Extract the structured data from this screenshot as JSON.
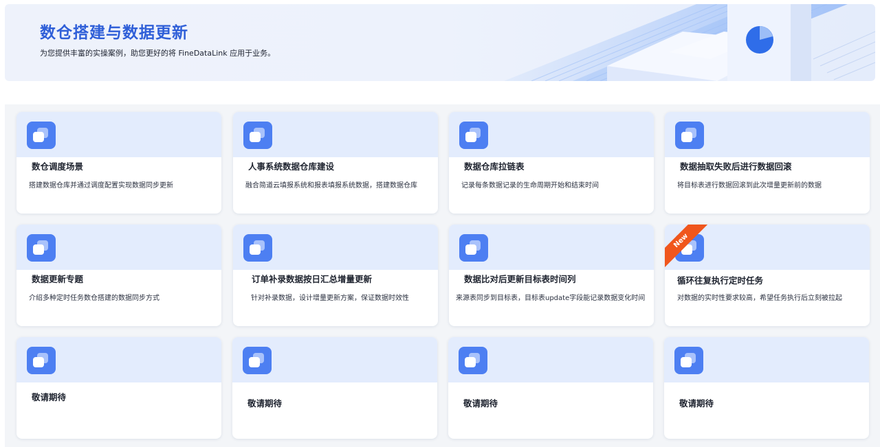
{
  "banner": {
    "title": "数仓搭建与数据更新",
    "subtitle": "为您提供丰富的实操案例，助您更好的将 FineDataLink 应用于业务。"
  },
  "cards": [
    {
      "title": "数仓调度场景",
      "desc": "搭建数据仓库并通过调度配置实现数据同步更新"
    },
    {
      "title": "人事系统数据仓库建设",
      "desc": "融合简道云填报系统和报表填报系统数据，搭建数据仓库"
    },
    {
      "title": "数据仓库拉链表",
      "desc": "记录每条数据记录的生命周期开始和结束时间"
    },
    {
      "title": "数据抽取失败后进行数据回滚",
      "desc": "将目标表进行数据回滚到此次增量更新前的数据"
    },
    {
      "title": "数据更新专题",
      "desc": "介绍多种定时任务数仓搭建的数据同步方式"
    },
    {
      "title": "订单补录数据按日汇总增量更新",
      "desc": "针对补录数据，设计增量更新方案，保证数据时效性"
    },
    {
      "title": "数据比对后更新目标表时间列",
      "desc": "来源表同步到目标表，目标表update字段能记录数据变化时间"
    },
    {
      "title": "循环往复执行定时任务",
      "desc": "对数据的实时性要求较高，希望任务执行后立刻被拉起",
      "badge": "New"
    },
    {
      "title": "敬请期待",
      "desc": ""
    },
    {
      "title": "敬请期待",
      "desc": ""
    },
    {
      "title": "敬请期待",
      "desc": ""
    },
    {
      "title": "敬请期待",
      "desc": ""
    }
  ],
  "colors": {
    "accent": "#2f5fd8",
    "icon": "#4d7ff2",
    "card_header": "#e3ecfd",
    "badge": "#f0561c"
  },
  "icons": {
    "card_icon": "stacked-squares-icon"
  }
}
